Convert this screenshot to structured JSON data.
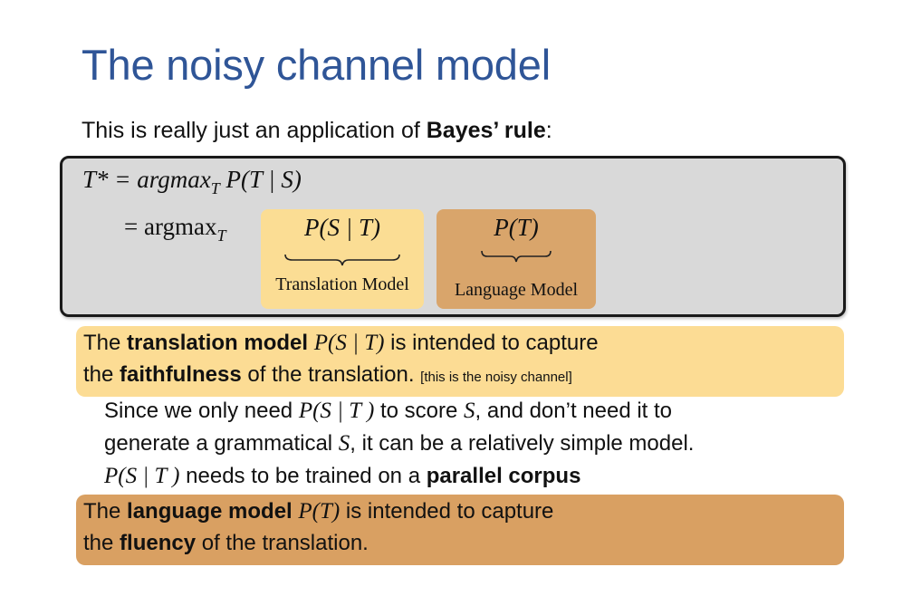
{
  "slide": {
    "title": "The noisy channel model",
    "intro": {
      "prefix": "This is really just an application of ",
      "bold": "Bayes’ rule",
      "suffix": ":"
    }
  },
  "equation": {
    "line1": "T* = argmax",
    "line1_sub": "T",
    "line1_rest": " P(T | S)",
    "line2": "= argmax",
    "line2_sub": "T",
    "tm_expr": "P(S | T)",
    "tm_label": "Translation Model",
    "lm_expr": "P(T)",
    "lm_label": "Language Model"
  },
  "translation_model": {
    "line1_pre": "The ",
    "line1_bold": "translation model",
    "line1_math": "P(S | T)",
    "line1_post": " is intended to capture",
    "line2_pre": "the ",
    "line2_bold": "faithfulness",
    "line2_post": " of the translation.",
    "note": "[this is the noisy channel]"
  },
  "details": {
    "d1a_pre": "Since we only need ",
    "d1a_math1": "P(S | T )",
    "d1a_mid": " to score ",
    "d1a_math2": "S",
    "d1a_post": ", and don’t need it to",
    "d1b_pre": "generate a grammatical ",
    "d1b_math": "S",
    "d1b_post": ", it can be a relatively simple model.",
    "d2_math": "P(S | T )",
    "d2_mid": " needs to be trained on a ",
    "d2_bold": "parallel corpus"
  },
  "language_model": {
    "line1_pre": "The ",
    "line1_bold": "language model",
    "line1_math": "P(T)",
    "line1_post": " is intended to capture",
    "line2_pre": "the ",
    "line2_bold": "fluency",
    "line2_post": " of the translation."
  },
  "colors": {
    "title": "#2f5597",
    "equation_box": "#d9d9d9",
    "translation_model": "#fcdc94",
    "language_model": "#d9a062"
  }
}
